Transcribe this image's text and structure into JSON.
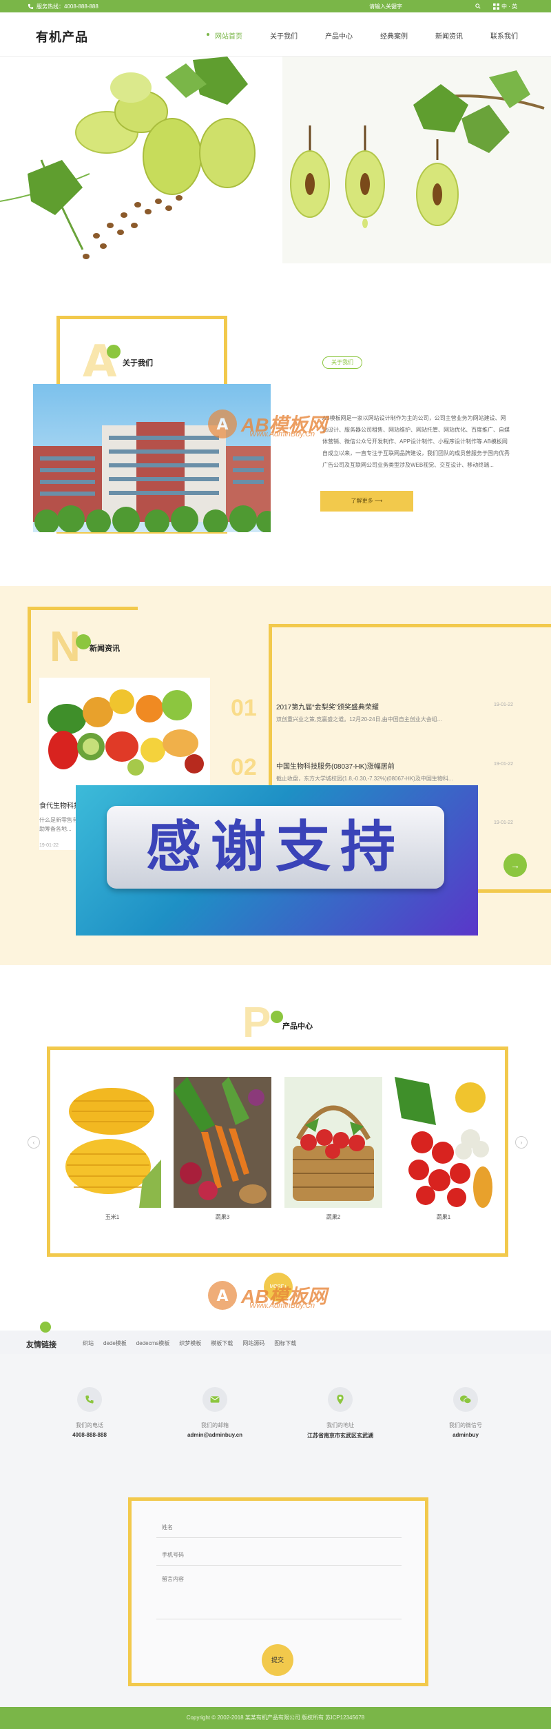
{
  "topbar": {
    "phone_label": "服务热线：4008-888-888",
    "search_placeholder": "请输入关键字",
    "lang": "中 · 英"
  },
  "header": {
    "logo": "有机产品",
    "nav": [
      "网站首页",
      "关于我们",
      "产品中心",
      "经典案例",
      "新闻资讯",
      "联系我们"
    ]
  },
  "about": {
    "letter": "A",
    "title": "关于我们",
    "tag": "关于我们",
    "text": "AB模板网是一家以网站设计制作为主的公司，公司主营业务为网站建设、网站设计、服务器公司租售、网站维护、网站托管、网站优化、百度推广、自媒体营销、微信公众号开发制作、APP设计制作、小程序设计制作等.AB模板网自成立以来，一直专注于互联网品牌建设，我们团队的成员曾服务于国内优秀广告公司及互联网公司业务类型涉及WEB视觉、交互设计、移动终端...",
    "more": "了解更多 ⟶"
  },
  "news": {
    "letter": "N",
    "title": "新闻资讯",
    "card": {
      "title": "食代生物科技...",
      "desc": "什么是新零售有哪些创新？随着互联网生物科技有限公司旗下员工帮助筹备各地...",
      "date": "19-01-22"
    },
    "items": [
      {
        "num": "01",
        "title": "2017第九届“金梨奖”颁奖盛典荣耀",
        "desc": "双创重兴业之策,竞赢盛之道。12月20-24日,由中国自主创业大会组...",
        "date": "19-01-22"
      },
      {
        "num": "02",
        "title": "中国生物科技服务(08037-HK)涨幅居前",
        "desc": "截止收盘，东方大学城校园(1.8,-0.30,-7.32%)(08067-HK)及中国生物科...",
        "date": "19-01-22"
      },
      {
        "num": "03",
        "title": "",
        "desc": "",
        "date": "19-01-22"
      }
    ],
    "next": "→"
  },
  "thanks": {
    "text": "感谢支持"
  },
  "products": {
    "letter": "P",
    "title": "产品中心",
    "items": [
      "玉米1",
      "蔬果3",
      "蔬果2",
      "蔬果1"
    ],
    "more": "MORE+",
    "prev": "‹",
    "next": "›"
  },
  "links": {
    "title": "友情链接",
    "items": [
      "织站",
      "dede模板",
      "dedecms模板",
      "织梦模板",
      "模板下载",
      "网站源码",
      "图标下载"
    ]
  },
  "contacts": [
    {
      "icon": "phone-icon",
      "label": "我们的电话",
      "value": "4008-888-888"
    },
    {
      "icon": "mail-icon",
      "label": "我们的邮箱",
      "value": "admin@adminbuy.cn"
    },
    {
      "icon": "location-icon",
      "label": "我们的地址",
      "value": "江苏省南京市玄武区玄武湖"
    },
    {
      "icon": "wechat-icon",
      "label": "我们的微信号",
      "value": "adminbuy"
    }
  ],
  "form": {
    "name_placeholder": "姓名",
    "phone_placeholder": "手机号码",
    "message_placeholder": "留言内容",
    "submit": "提交"
  },
  "footer": {
    "copyright": "Copyright © 2002-2018 某某有机产品有限公司 版权所有 苏ICP12345678"
  },
  "watermark": {
    "big": "AB模板网",
    "small": "Www.AdminBuy.Cn"
  },
  "colors": {
    "brand_green": "#7ab648",
    "accent_yellow": "#f2c94c",
    "cream": "#fdf4dd"
  }
}
